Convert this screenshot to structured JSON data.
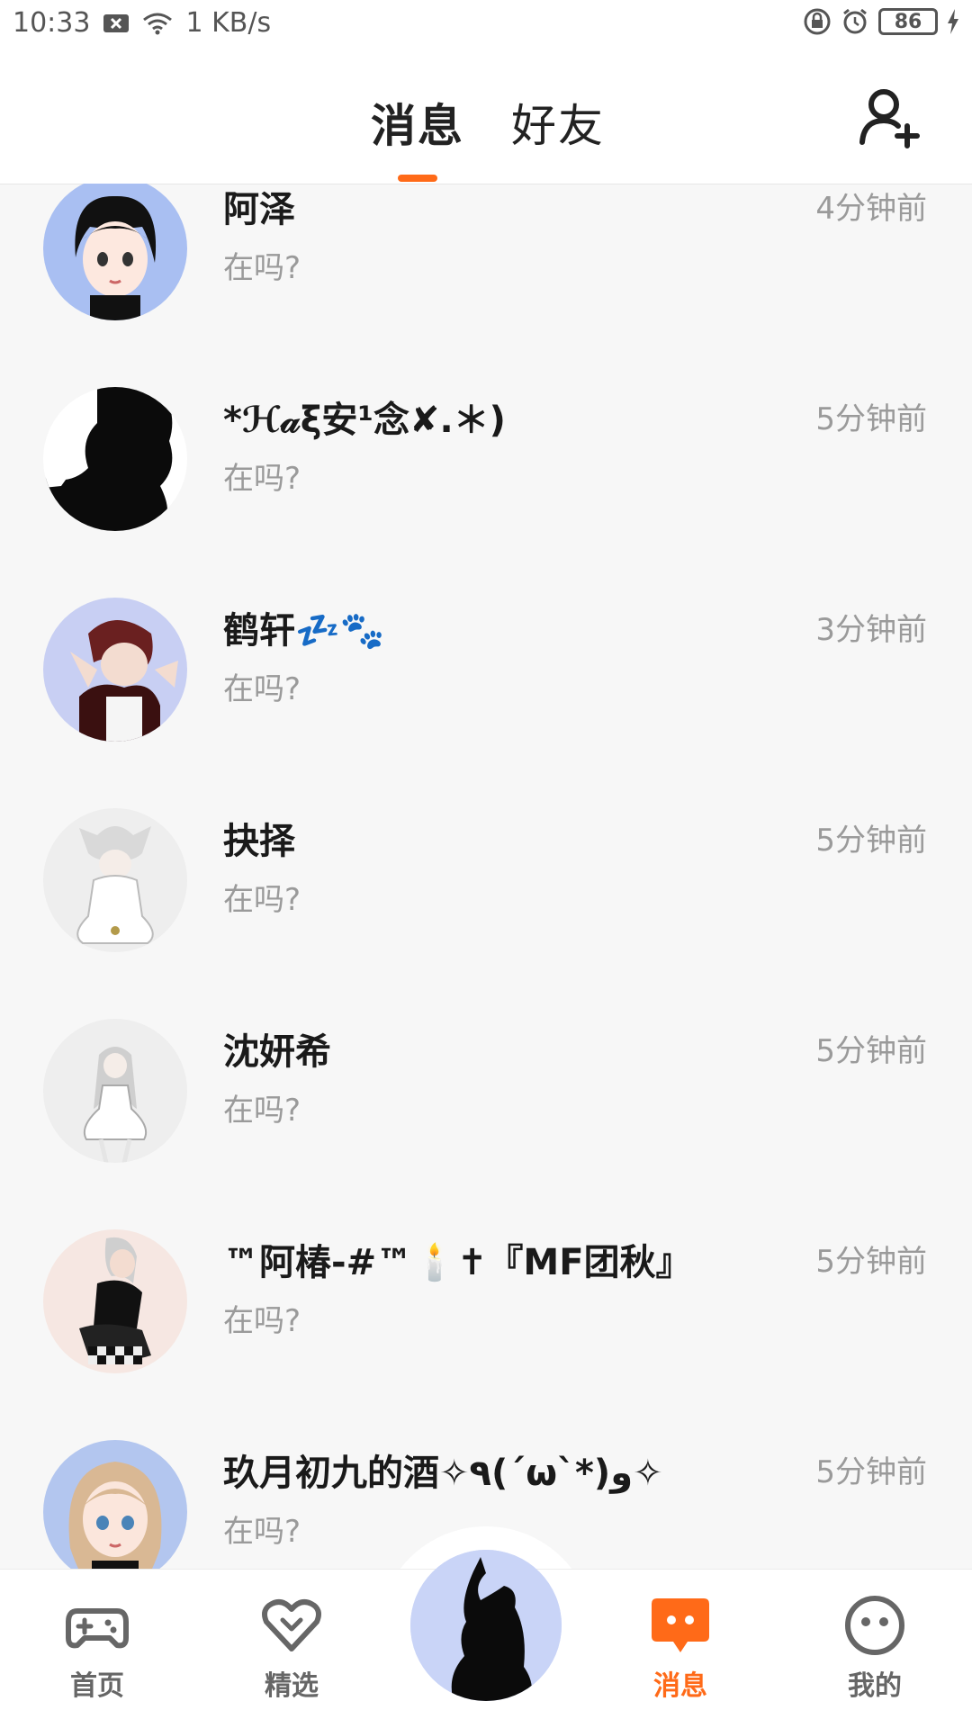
{
  "status_bar": {
    "time": "10:33",
    "network_speed": "1 KB/s",
    "battery": "86",
    "icons": [
      "notification-x-icon",
      "wifi-icon",
      "lock-rotation-icon",
      "alarm-icon",
      "battery-icon",
      "charging-icon"
    ]
  },
  "header": {
    "tabs": [
      {
        "label": "消息",
        "active": true
      },
      {
        "label": "好友",
        "active": false
      }
    ],
    "add_friend_icon": "add-user-icon",
    "accent_color": "#ff6a18"
  },
  "conversations": [
    {
      "name": "阿泽",
      "time": "4分钟前",
      "preview": "在吗?"
    },
    {
      "name": "*ℋ𝒶ξ安¹念✘.＊)",
      "time": "5分钟前",
      "preview": "在吗?"
    },
    {
      "name": "鹤轩💤🐾",
      "time": "3分钟前",
      "preview": "在吗?"
    },
    {
      "name": "抉择",
      "time": "5分钟前",
      "preview": "在吗?"
    },
    {
      "name": "沈妍希",
      "time": "5分钟前",
      "preview": "在吗?"
    },
    {
      "name": "™阿椿-#™🕯️✝『MF团秋』",
      "time": "5分钟前",
      "preview": "在吗?"
    },
    {
      "name": "玖月初九的酒✧٩(ˊωˋ*)و✧",
      "time": "5分钟前",
      "preview": "在吗?"
    }
  ],
  "bottom_nav": {
    "items": [
      {
        "label": "首页",
        "icon": "gamepad-icon",
        "active": false
      },
      {
        "label": "精选",
        "icon": "heart-chevron-icon",
        "active": false
      },
      {
        "label": "消息",
        "icon": "chat-bubble-icon",
        "active": true
      },
      {
        "label": "我的",
        "icon": "smiley-face-icon",
        "active": false
      }
    ],
    "center_icon": "avatar-center-icon"
  }
}
